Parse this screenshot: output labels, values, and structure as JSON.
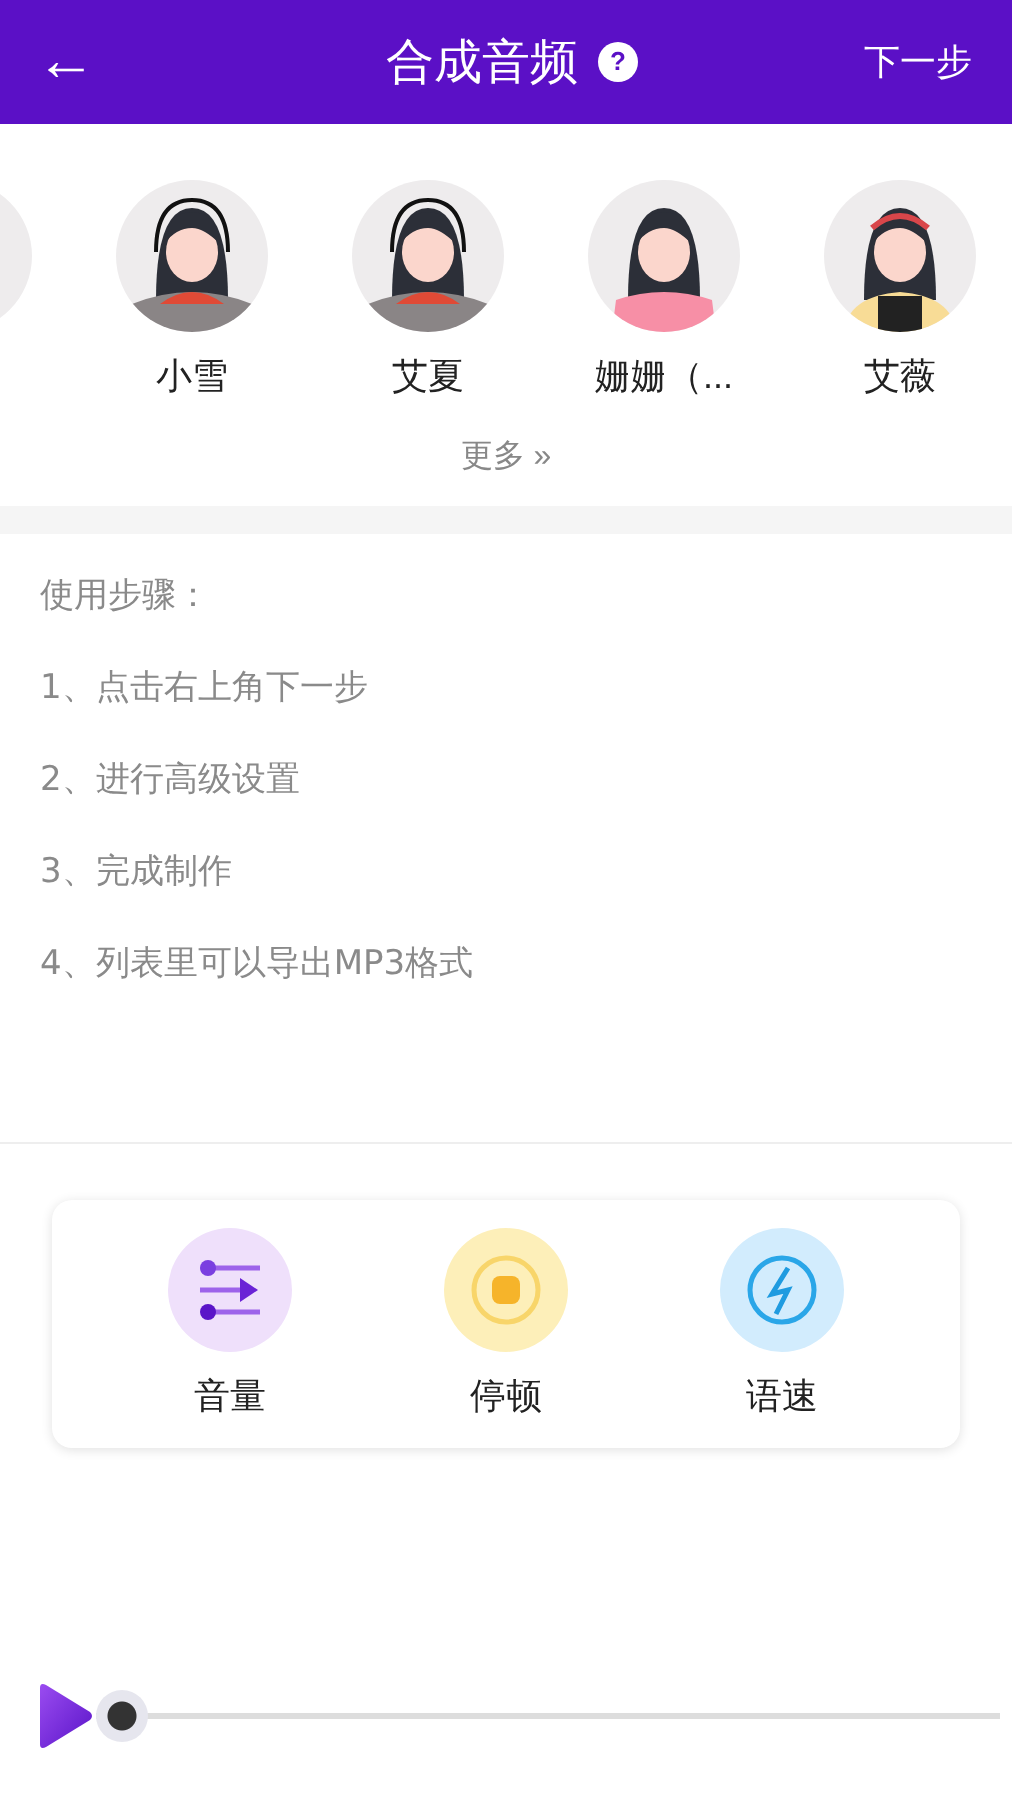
{
  "header": {
    "back": "←",
    "title": "合成音频",
    "help": "?",
    "next": "下一步"
  },
  "edge_avatar": true,
  "voices": [
    {
      "name": "小雪",
      "kind": "headset"
    },
    {
      "name": "艾夏",
      "kind": "headset"
    },
    {
      "name": "姗姗（...",
      "kind": "pink"
    },
    {
      "name": "艾薇",
      "kind": "apron"
    }
  ],
  "more": "更多 »",
  "steps": [
    "使用步骤：",
    "1、点击右上角下一步",
    "2、进行高级设置",
    "3、完成制作",
    "4、列表里可以导出MP3格式"
  ],
  "tools": [
    {
      "label": "音量",
      "kind": "volume"
    },
    {
      "label": "停顿",
      "kind": "pause"
    },
    {
      "label": "语速",
      "kind": "speed"
    }
  ],
  "player": {
    "level": 0
  }
}
